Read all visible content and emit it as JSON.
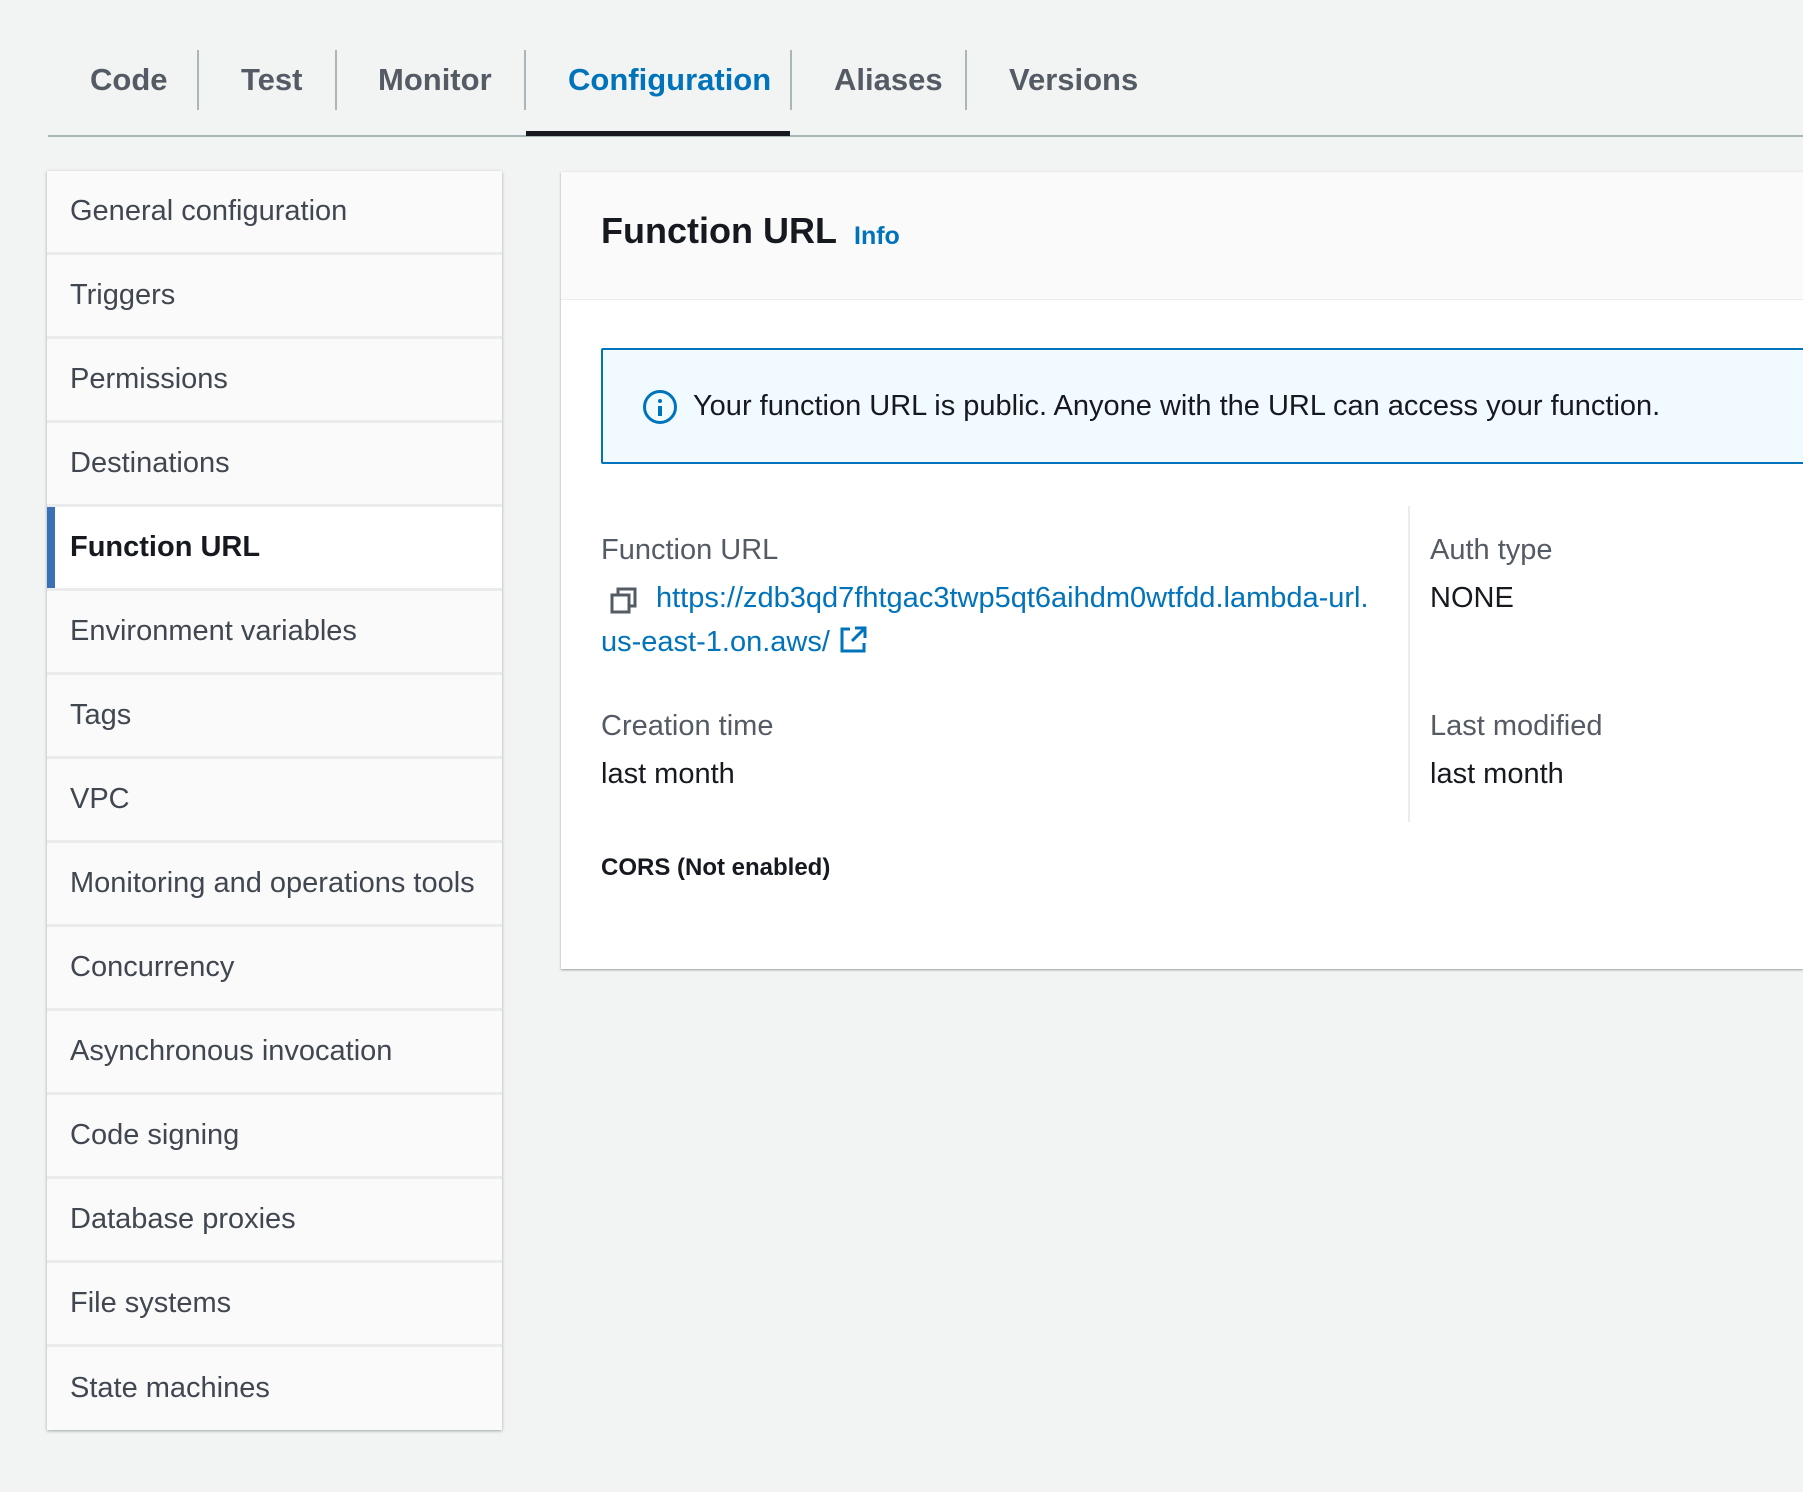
{
  "tabs": [
    {
      "label": "Code"
    },
    {
      "label": "Test"
    },
    {
      "label": "Monitor"
    },
    {
      "label": "Configuration",
      "active": true
    },
    {
      "label": "Aliases"
    },
    {
      "label": "Versions"
    }
  ],
  "sidebar": {
    "items": [
      {
        "label": "General configuration"
      },
      {
        "label": "Triggers"
      },
      {
        "label": "Permissions"
      },
      {
        "label": "Destinations"
      },
      {
        "label": "Function URL",
        "active": true
      },
      {
        "label": "Environment variables"
      },
      {
        "label": "Tags"
      },
      {
        "label": "VPC"
      },
      {
        "label": "Monitoring and operations tools"
      },
      {
        "label": "Concurrency"
      },
      {
        "label": "Asynchronous invocation"
      },
      {
        "label": "Code signing"
      },
      {
        "label": "Database proxies"
      },
      {
        "label": "File systems"
      },
      {
        "label": "State machines"
      }
    ]
  },
  "panel": {
    "title": "Function URL",
    "info_label": "Info",
    "alert": {
      "icon": "info-circle-icon",
      "text": "Your function URL is public. Anyone with the URL can access your function."
    },
    "function_url": {
      "label": "Function URL",
      "value": "https://zdb3qd7fhtgac3twp5qt6aihdm0wtfdd.lambda-url.us-east-1.on.aws/",
      "copy_icon": "copy-icon",
      "external_icon": "external-link-icon"
    },
    "auth_type": {
      "label": "Auth type",
      "value": "NONE"
    },
    "creation_time": {
      "label": "Creation time",
      "value": "last month"
    },
    "last_modified": {
      "label": "Last modified",
      "value": "last month"
    },
    "cors_label": "CORS (Not enabled)"
  },
  "colors": {
    "accent": "#0073bb",
    "active_marker": "#3b6fb6",
    "background": "#f2f3f3",
    "alert_background": "#f1faff"
  }
}
